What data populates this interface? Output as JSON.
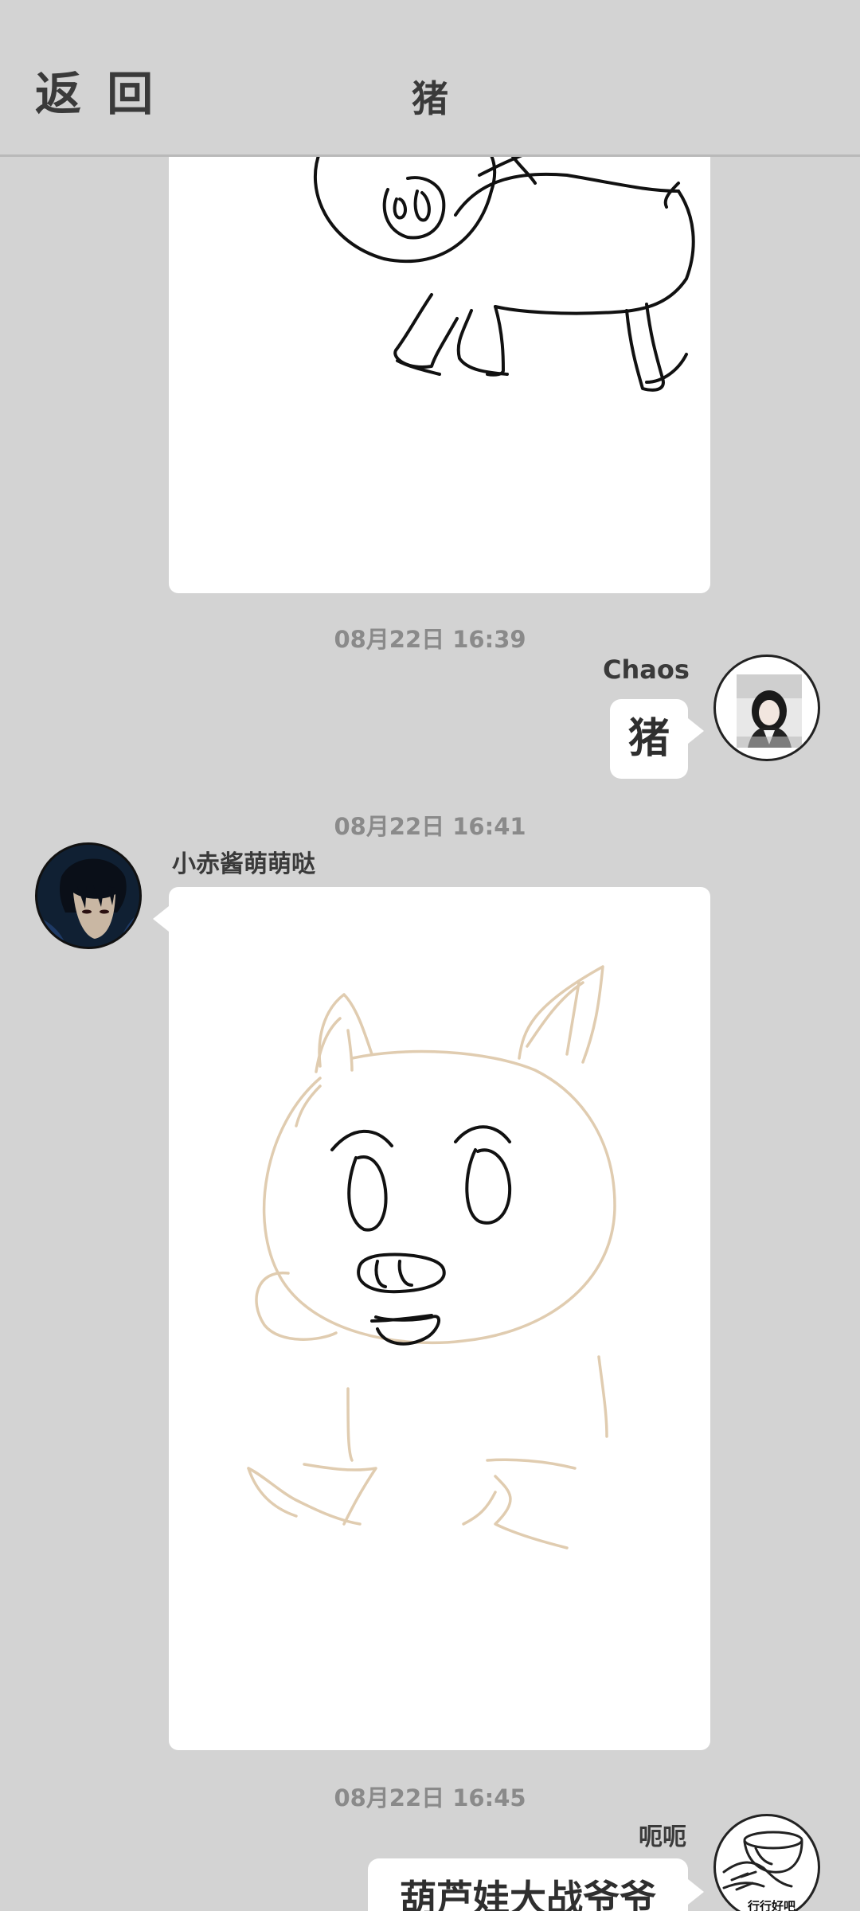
{
  "header": {
    "back_label": "返 回",
    "title": "猪"
  },
  "messages": [
    {
      "type": "drawing",
      "side": "left",
      "content": "pig doodle (black lines)"
    },
    {
      "type": "timestamp",
      "text": "08月22日  16:39"
    },
    {
      "type": "text",
      "side": "right",
      "sender": "Chaos",
      "text": "猪",
      "avatar": "girl-photo-avatar"
    },
    {
      "type": "timestamp",
      "text": "08月22日  16:41"
    },
    {
      "type": "drawing",
      "side": "left",
      "sender": "小赤酱萌萌哒",
      "avatar": "anime-character-avatar",
      "content": "pig doodle (beige outline with black face)"
    },
    {
      "type": "timestamp",
      "text": "08月22日  16:45"
    },
    {
      "type": "text",
      "side": "right",
      "sender": "呃呃",
      "text": "葫芦娃大战爷爷",
      "avatar": "meme-sticker-avatar",
      "avatar_caption": "行行好吧"
    }
  ],
  "colors": {
    "background": "#d3d3d3",
    "card": "#ffffff",
    "text": "#3a3a3a",
    "timestamp": "#8a8a8a",
    "beige_stroke": "#e0ccb0",
    "black_stroke": "#111111"
  }
}
